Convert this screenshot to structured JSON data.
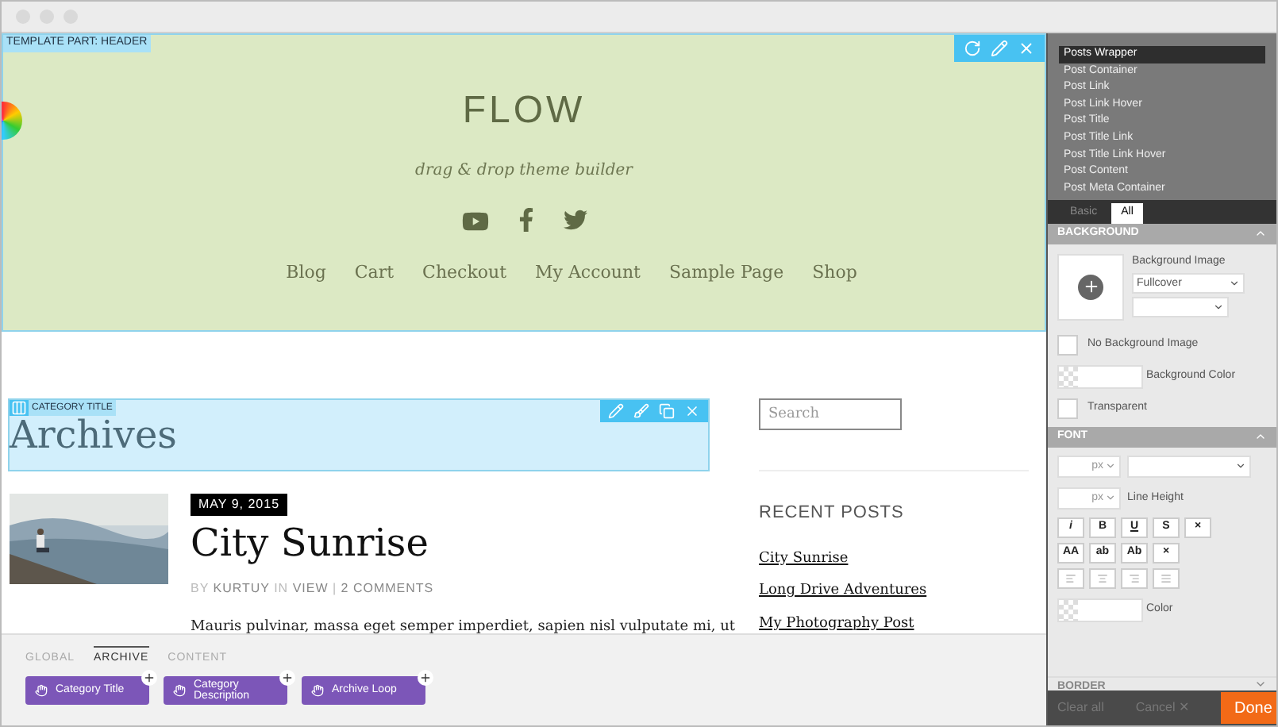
{
  "header_part": {
    "label": "TEMPLATE PART: HEADER",
    "site_title": "FLOW",
    "tagline": "drag & drop theme builder",
    "nav": [
      "Blog",
      "Cart",
      "Checkout",
      "My Account",
      "Sample Page",
      "Shop"
    ]
  },
  "category_title": {
    "label": "CATEGORY TITLE",
    "heading": "Archives"
  },
  "post": {
    "date": "MAY 9, 2015",
    "title": "City Sunrise",
    "meta": [
      {
        "text": "BY ",
        "kind": "plain"
      },
      {
        "text": "KURTUY",
        "kind": "link"
      },
      {
        "text": " IN ",
        "kind": "plain"
      },
      {
        "text": "VIEW",
        "kind": "link"
      },
      {
        "text": " | ",
        "kind": "plain"
      },
      {
        "text": "2 COMMENTS",
        "kind": "link"
      }
    ],
    "excerpt": "Mauris pulvinar, massa eget semper imperdiet, sapien nisl vulputate mi, ut"
  },
  "sidebar": {
    "search": {
      "placeholder": "Search"
    },
    "recent_title": "RECENT POSTS",
    "recent": [
      "City Sunrise",
      "Long Drive Adventures",
      "My Photography Post"
    ]
  },
  "bottom_panel": {
    "tabs": [
      {
        "label": "GLOBAL",
        "selected": false
      },
      {
        "label": "ARCHIVE",
        "selected": true
      },
      {
        "label": "CONTENT",
        "selected": false
      }
    ],
    "modules": [
      "Category Title",
      "Category Description",
      "Archive Loop"
    ]
  },
  "style_panel": {
    "selectors": [
      {
        "label": "Posts Wrapper",
        "selected": true
      },
      {
        "label": "Post Container",
        "selected": false
      },
      {
        "label": "Post Link",
        "selected": false
      },
      {
        "label": "Post Link Hover",
        "selected": false
      },
      {
        "label": "Post Title",
        "selected": false
      },
      {
        "label": "Post Title Link",
        "selected": false
      },
      {
        "label": "Post Title Link Hover",
        "selected": false
      },
      {
        "label": "Post Content",
        "selected": false
      },
      {
        "label": "Post Meta Container",
        "selected": false
      }
    ],
    "tabs": [
      {
        "label": "Basic",
        "selected": false
      },
      {
        "label": "All",
        "selected": true
      }
    ],
    "background": {
      "title": "BACKGROUND",
      "image_label": "Background Image",
      "image_mode": "Fullcover",
      "no_image": {
        "label": "No Background Image",
        "checked": false
      },
      "color_label": "Background Color",
      "transparent": {
        "label": "Transparent",
        "checked": false
      }
    },
    "font": {
      "title": "FONT",
      "size_unit": "px",
      "line_unit": "px",
      "line_label": "Line Height",
      "style_buttons": [
        "i",
        "B",
        "U",
        "S",
        "×"
      ],
      "case_buttons": [
        "AA",
        "ab",
        "Ab",
        "×"
      ],
      "color_label": "Color"
    },
    "border_title": "BORDER",
    "footer": {
      "clear": "Clear all",
      "cancel": "Cancel ✕",
      "done": "Done"
    }
  }
}
